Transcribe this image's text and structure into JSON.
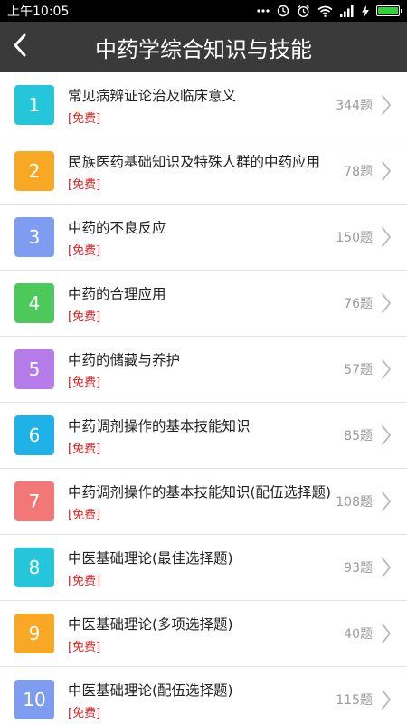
{
  "status_bar": {
    "time": "上午10:05",
    "icons": [
      "more-dots-icon",
      "sync-icon",
      "alarm-icon",
      "wifi-icon",
      "signal-icon",
      "charging-icon",
      "battery-icon"
    ],
    "battery_color": "#36d13a"
  },
  "header": {
    "title": "中药学综合知识与技能",
    "back_icon": "back-arrow-icon"
  },
  "items": [
    {
      "num": "1",
      "title": "常见病辨证论治及临床意义",
      "tag": "[免费]",
      "count": "344题",
      "color": "#26c6da"
    },
    {
      "num": "2",
      "title": "民族医药基础知识及特殊人群的中药应用",
      "tag": "[免费]",
      "count": "78题",
      "color": "#f9a825"
    },
    {
      "num": "3",
      "title": "中药的不良反应",
      "tag": "[免费]",
      "count": "150题",
      "color": "#7e9cf0"
    },
    {
      "num": "4",
      "title": "中药的合理应用",
      "tag": "[免费]",
      "count": "76题",
      "color": "#4cc95a"
    },
    {
      "num": "5",
      "title": "中药的储藏与养护",
      "tag": "[免费]",
      "count": "57题",
      "color": "#b57be8"
    },
    {
      "num": "6",
      "title": "中药调剂操作的基本技能知识",
      "tag": "[免费]",
      "count": "85题",
      "color": "#1eb2e8"
    },
    {
      "num": "7",
      "title": "中药调剂操作的基本技能知识(配伍选择题)",
      "tag": "[免费]",
      "count": "108题",
      "color": "#f27777"
    },
    {
      "num": "8",
      "title": "中医基础理论(最佳选择题)",
      "tag": "[免费]",
      "count": "93题",
      "color": "#26c6da"
    },
    {
      "num": "9",
      "title": "中医基础理论(多项选择题)",
      "tag": "[免费]",
      "count": "40题",
      "color": "#f9a825"
    },
    {
      "num": "10",
      "title": "中医基础理论(配伍选择题)",
      "tag": "[免费]",
      "count": "115题",
      "color": "#7e9cf0"
    }
  ]
}
